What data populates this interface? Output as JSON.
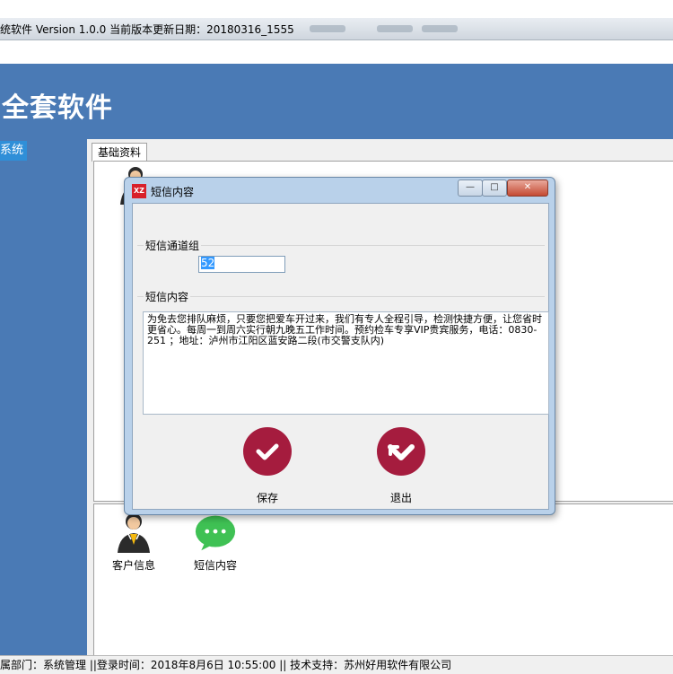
{
  "window": {
    "title": "统软件 Version 1.0.0 当前版本更新日期：20180316_1555"
  },
  "banner": {
    "title": "全套软件"
  },
  "nav": {
    "active_item": "系统"
  },
  "tabs": [
    {
      "label": "基础资料"
    }
  ],
  "modules": {
    "customer": {
      "label": "客户信息"
    },
    "sms": {
      "label": "短信内容"
    },
    "customer_partial": {
      "label": "客"
    }
  },
  "dialog": {
    "title": "短信内容",
    "logo_text": "XZ",
    "group_channel": {
      "label": "短信通道组",
      "value": "52"
    },
    "group_content": {
      "label": "短信内容",
      "value": "为免去您排队麻烦，只要您把爱车开过来，我们有专人全程引导，检测快捷方便，让您省时更省心。每周一到周六实行朝九晚五工作时间。预约检车专享VIP贵宾服务，电话：0830-251     ；地址：泸州市江阳区蓝安路二段(市交警支队内)"
    },
    "buttons": {
      "save": "保存",
      "exit": "退出"
    }
  },
  "statusbar": {
    "text": "属部门：系统管理  ||登录时间：2018年8月6日 10:55:00 || 技术支持：苏州好用软件有限公司"
  },
  "colors": {
    "accent_blue": "#4a7ab5",
    "button_red": "#a51c3e",
    "sms_green": "#3fc154"
  }
}
